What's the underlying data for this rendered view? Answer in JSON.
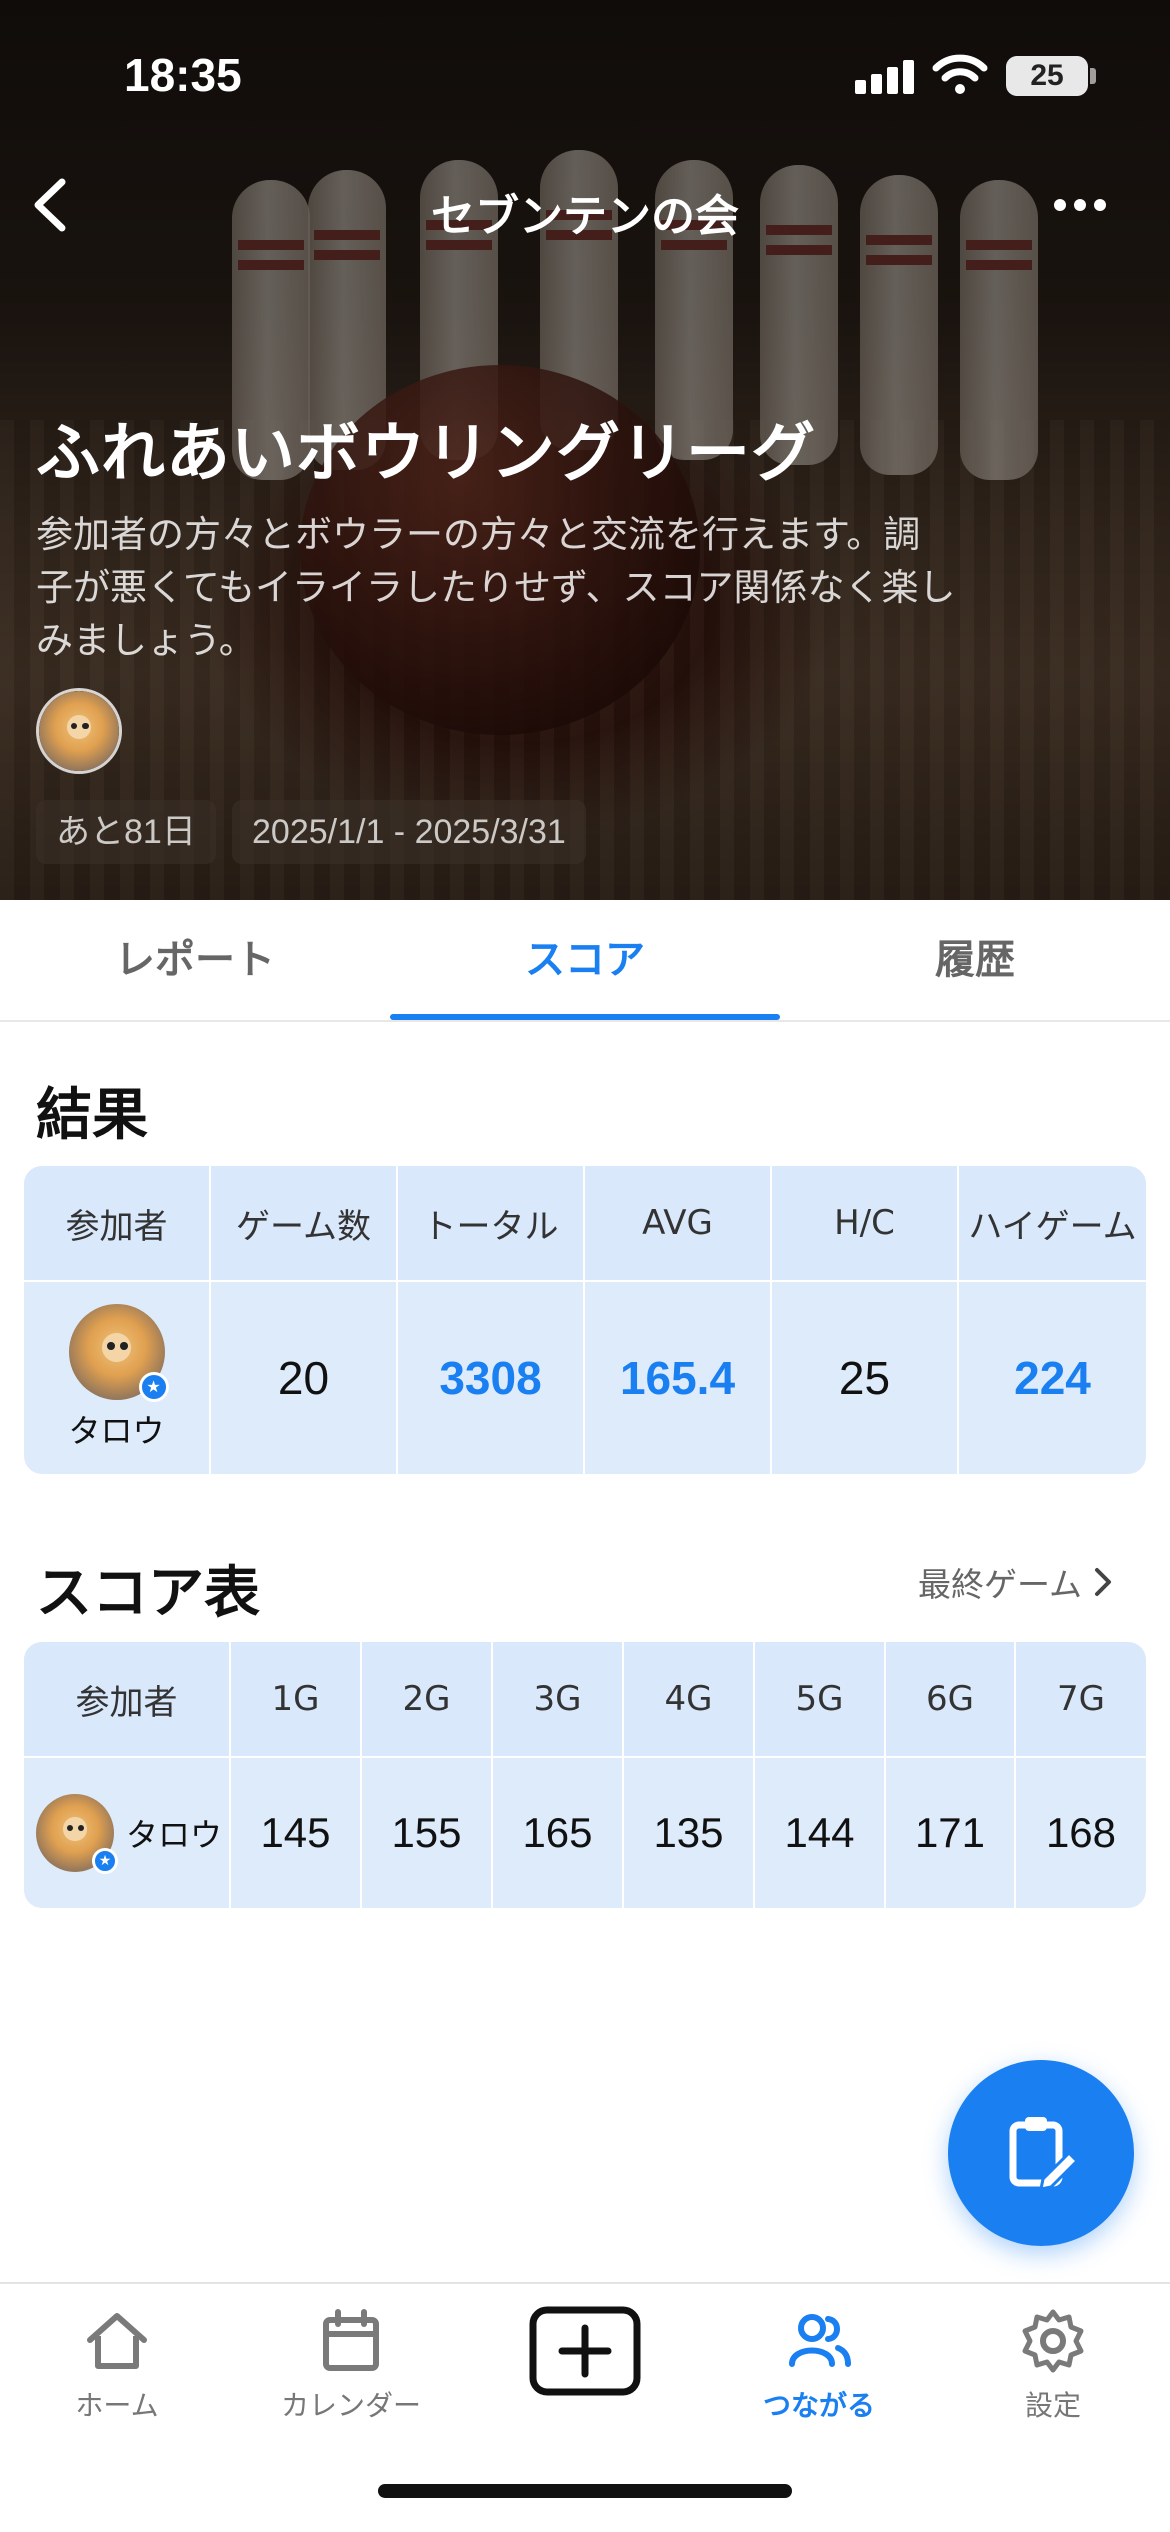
{
  "status_bar": {
    "time": "18:35",
    "battery": "25"
  },
  "nav": {
    "title": "セブンテンの会"
  },
  "event": {
    "title": "ふれあいボウリングリーグ",
    "description": "参加者の方々とボウラーの方々と交流を行えます。調子が悪くてもイライラしたりせず、スコア関係なく楽しみましょう。",
    "remaining": "あと81日",
    "period": "2025/1/1 - 2025/3/31"
  },
  "tabs": [
    {
      "label": "レポート",
      "active": false
    },
    {
      "label": "スコア",
      "active": true
    },
    {
      "label": "履歴",
      "active": false
    }
  ],
  "results": {
    "title": "結果",
    "headers": [
      "参加者",
      "ゲーム数",
      "トータル",
      "AVG",
      "H/C",
      "ハイゲーム"
    ],
    "row": {
      "name": "タロウ",
      "games": "20",
      "total": "3308",
      "avg": "165.4",
      "hc": "25",
      "high": "224"
    }
  },
  "score_table": {
    "title": "スコア表",
    "link": "最終ゲーム",
    "headers": [
      "参加者",
      "1G",
      "2G",
      "3G",
      "4G",
      "5G",
      "6G",
      "7G"
    ],
    "row": {
      "name": "タロウ",
      "scores": [
        "145",
        "155",
        "165",
        "135",
        "144",
        "171",
        "168"
      ]
    }
  },
  "bottom_nav": [
    {
      "label": "ホーム",
      "icon": "home-icon",
      "active": false
    },
    {
      "label": "カレンダー",
      "icon": "calendar-icon",
      "active": false
    },
    {
      "label": "",
      "icon": "add-icon",
      "active": false
    },
    {
      "label": "つながる",
      "icon": "people-icon",
      "active": true
    },
    {
      "label": "設定",
      "icon": "gear-icon",
      "active": false
    }
  ],
  "colors": {
    "accent": "#1a7ff0",
    "table_bg": "#ddebfb"
  }
}
